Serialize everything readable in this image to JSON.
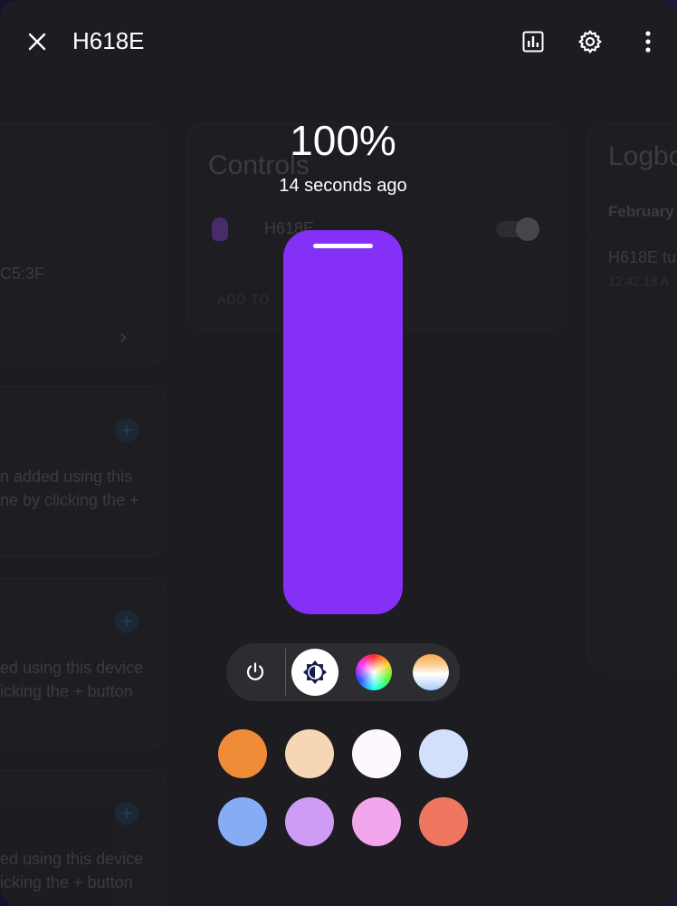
{
  "header": {
    "title": "H618E",
    "close_icon": "close-icon",
    "history_icon": "history-chart-icon",
    "settings_icon": "gear-icon",
    "more_icon": "more-vertical-icon"
  },
  "light": {
    "brightness_label": "100%",
    "brightness_value": 100,
    "last_changed": "14 seconds ago",
    "color": "#8430f6"
  },
  "modes": [
    {
      "name": "power",
      "icon": "power-icon"
    },
    {
      "name": "brightness",
      "icon": "brightness-icon",
      "selected": true
    },
    {
      "name": "color",
      "icon": "color-wheel-icon"
    },
    {
      "name": "color-temp",
      "icon": "color-temperature-icon"
    }
  ],
  "favorite_colors": [
    "#f08c38",
    "#f7d6b5",
    "#fdf7ff",
    "#d3e0fb",
    "#86acf6",
    "#cf9cf4",
    "#f2a6ec",
    "#ef7760"
  ],
  "background": {
    "controls_card": {
      "title": "Controls",
      "entity_name": "H618E",
      "action": "ADD TO"
    },
    "logbook_card": {
      "title": "Logbo",
      "date": "February",
      "entry": "H618E tu",
      "time": "12:42:18 A"
    },
    "device_card": {
      "mac": "C5:3F"
    },
    "automation_cards": [
      {
        "line1": "n added using this",
        "line2": "ne by clicking the +"
      },
      {
        "line1": "ed using this device",
        "line2": "icking the + button"
      },
      {
        "line1": "ed using this device",
        "line2": "icking the + button"
      }
    ]
  }
}
